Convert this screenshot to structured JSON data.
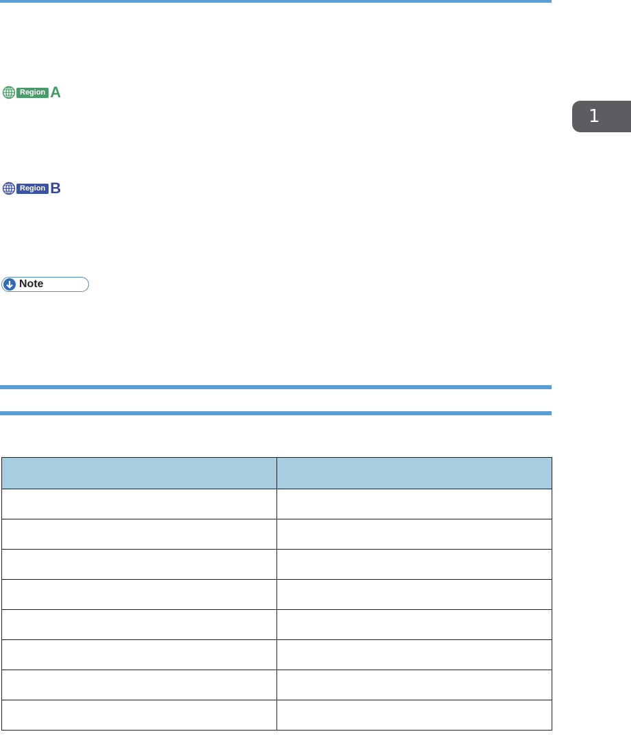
{
  "chapter_tab": {
    "number": "1"
  },
  "regions": [
    {
      "label": "Region",
      "letter": "A"
    },
    {
      "label": "Region",
      "letter": "B"
    }
  ],
  "note": {
    "label": "Note"
  },
  "table": {
    "headers": [
      "",
      ""
    ],
    "rows": [
      [
        "",
        ""
      ],
      [
        "",
        ""
      ],
      [
        "",
        ""
      ],
      [
        "",
        ""
      ],
      [
        "",
        ""
      ],
      [
        "",
        ""
      ],
      [
        "",
        ""
      ],
      [
        "",
        ""
      ]
    ]
  },
  "colors": {
    "rule": "#5b9fd6",
    "region_a": "#3f9b5f",
    "region_b": "#3548a0",
    "table_header": "#a6cde0",
    "chapter_tab": "#5b5d60"
  }
}
